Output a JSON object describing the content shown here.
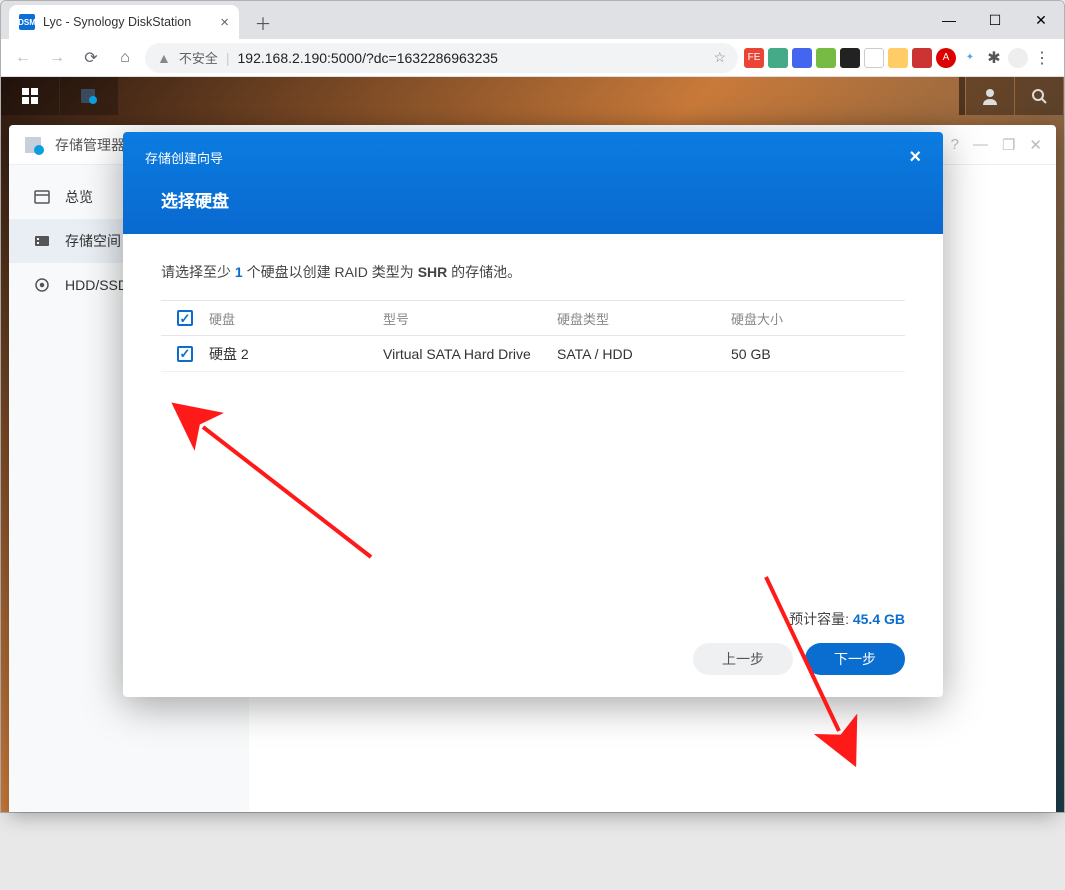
{
  "browser": {
    "tab_title": "Lyc - Synology DiskStation",
    "favicon_text": "DSM",
    "insecure_label": "不安全",
    "url": "192.168.2.190:5000/?dc=1632286963235"
  },
  "dsm": {},
  "storage_manager": {
    "title": "存储管理器",
    "sidebar": {
      "items": [
        {
          "label": "总览"
        },
        {
          "label": "存储空间"
        },
        {
          "label": "HDD/SSD"
        }
      ]
    }
  },
  "wizard": {
    "title": "存储创建向导",
    "step_title": "选择硬盘",
    "instruction_prefix": "请选择至少 ",
    "instruction_count": "1",
    "instruction_mid": " 个硬盘以创建 RAID 类型为 ",
    "instruction_raid": "SHR",
    "instruction_suffix": " 的存储池。",
    "columns": {
      "disk": "硬盘",
      "model": "型号",
      "type": "硬盘类型",
      "size": "硬盘大小"
    },
    "rows": [
      {
        "checked": true,
        "disk": "硬盘 2",
        "model": "Virtual SATA Hard Drive",
        "type": "SATA / HDD",
        "size": "50 GB"
      }
    ],
    "estimated_label": "预计容量: ",
    "estimated_value": "45.4 GB",
    "prev_label": "上一步",
    "next_label": "下一步"
  }
}
